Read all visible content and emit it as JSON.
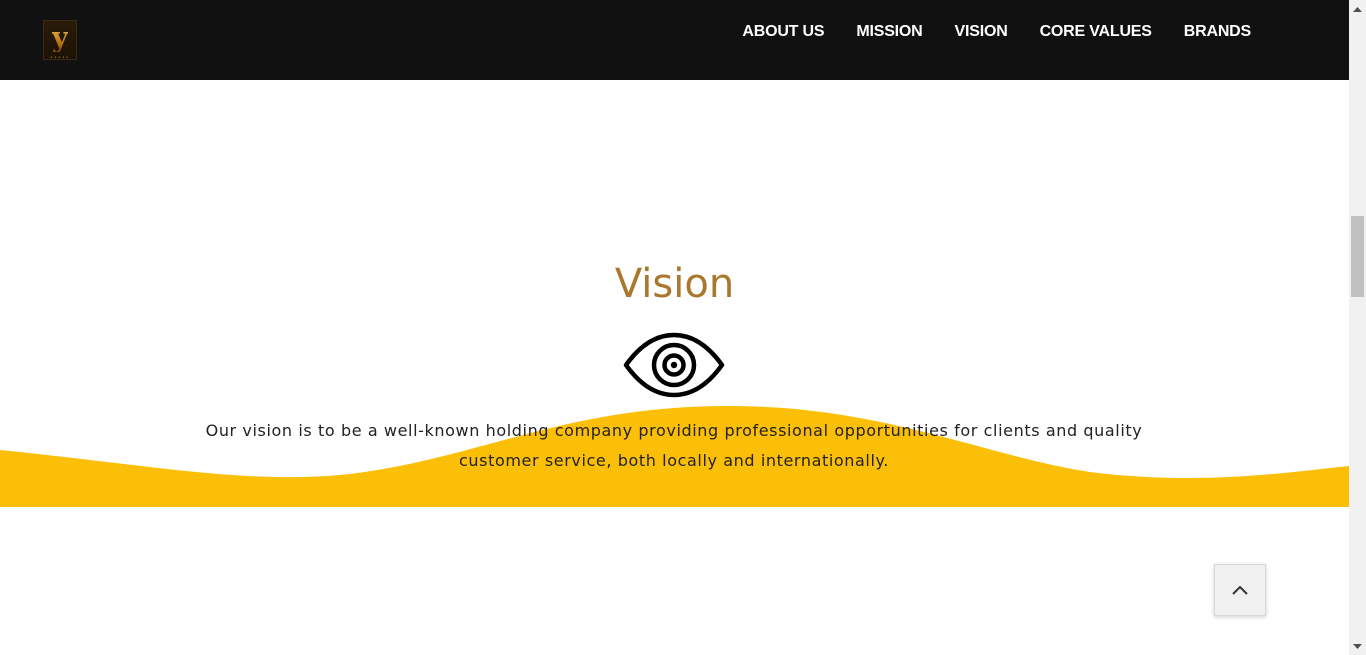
{
  "header": {
    "logo_letter": "y",
    "logo_dots": "•••••",
    "nav": [
      {
        "label": "ABOUT US"
      },
      {
        "label": "MISSION"
      },
      {
        "label": "VISION"
      },
      {
        "label": "CORE VALUES"
      },
      {
        "label": "BRANDS"
      }
    ]
  },
  "vision": {
    "title": "Vision",
    "icon": "eye-icon",
    "text": "Our vision is to be a well-known holding company providing professional opportunities for clients and quality customer service, both locally and internationally."
  },
  "colors": {
    "header_bg": "#111111",
    "title": "#a9772d",
    "wave": "#fcbf07",
    "text": "#222222"
  },
  "icons": {
    "back_to_top": "chevron-up-icon",
    "scroll_up": "scroll-up-arrow-icon",
    "scroll_down": "scroll-down-arrow-icon"
  }
}
